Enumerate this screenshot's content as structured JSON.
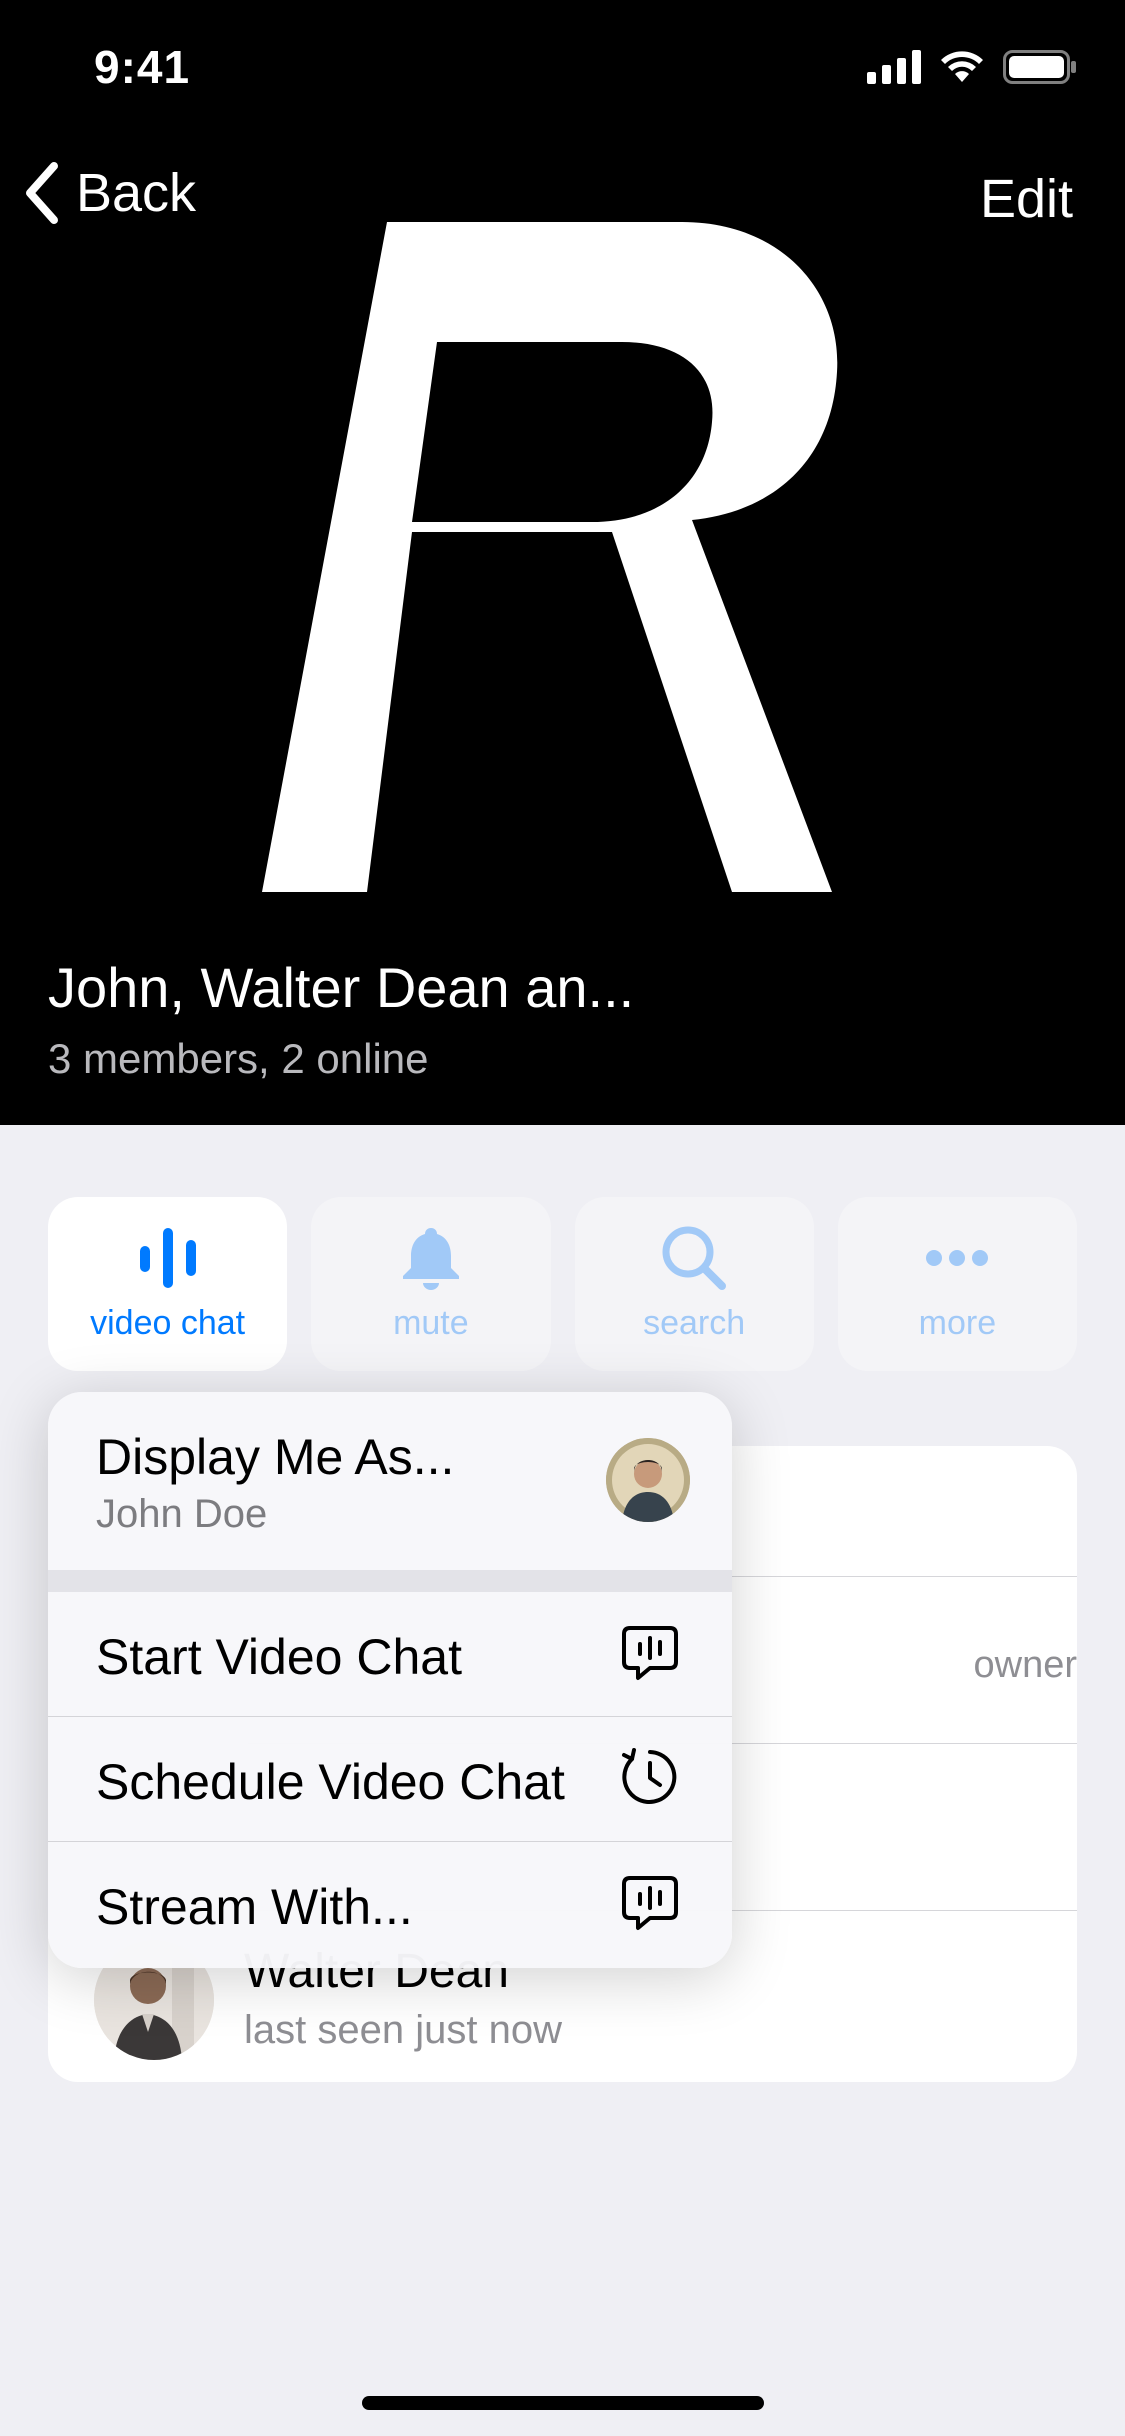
{
  "status_bar": {
    "time": "9:41"
  },
  "nav": {
    "back_label": "Back",
    "edit_label": "Edit"
  },
  "group": {
    "avatar_letter": "R",
    "title": "John, Walter Dean an...",
    "subtitle": "3 members, 2 online"
  },
  "actions": [
    {
      "label": "video chat",
      "icon": "voice-waves-icon"
    },
    {
      "label": "mute",
      "icon": "bell-icon"
    },
    {
      "label": "search",
      "icon": "magnifier-icon"
    },
    {
      "label": "more",
      "icon": "ellipsis-icon"
    }
  ],
  "context_menu": {
    "display_as": {
      "title": "Display Me As...",
      "subtitle": "John Doe"
    },
    "items": [
      {
        "label": "Start Video Chat",
        "icon": "video-chat-icon"
      },
      {
        "label": "Schedule Video Chat",
        "icon": "schedule-clock-icon"
      },
      {
        "label": "Stream With...",
        "icon": "stream-icon"
      }
    ]
  },
  "members": {
    "owner_role": "owner",
    "last_member": {
      "name": "Walter Dean",
      "status": "last seen just now"
    }
  },
  "colors": {
    "accent": "#007aff",
    "header_bg": "#000000",
    "page_bg": "#efeff4"
  }
}
